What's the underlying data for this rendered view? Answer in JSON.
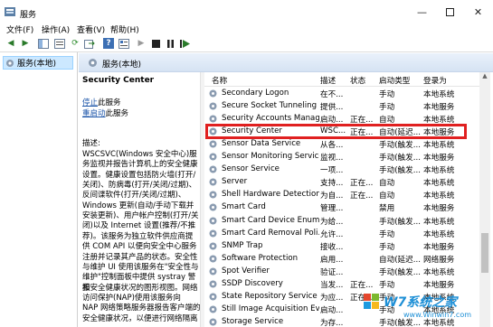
{
  "window": {
    "title": "服务"
  },
  "menubar": {
    "items": [
      "文件(F)",
      "操作(A)",
      "查看(V)",
      "帮助(H)"
    ]
  },
  "tree": {
    "root": "服务(本地)"
  },
  "main": {
    "header": "服务(本地)"
  },
  "description": {
    "service_name": "Security Center",
    "stop_link": "停止",
    "stop_suffix": "此服务",
    "restart_link": "重启动",
    "restart_suffix": "此服务",
    "desc_label": "描述:",
    "desc_lines": [
      "WSCSVC(Windows 安全中心)服",
      "务监视并报告计算机上的安全健康",
      "设置。健康设置包括防火墙(打开/",
      "关闭)、防病毒(打开/关闭/过期)、",
      "反间谍软件(打开/关闭/过期)、",
      "Windows 更新(自动/手动下载并",
      "安装更新)、用户帐户控制(打开/关",
      "闭)以及 Internet 设置(推荐/不推",
      "荐)。该服务为独立软件供应商提",
      "供 COM API 以便向安全中心服务",
      "注册并记录其产品的状态。安全性",
      "与维护 UI 使用该服务在\"安全性与",
      "维护\"控制面板中提供 systray 警报",
      "和安全健康状况的图形视图。网络",
      "访问保护(NAP)使用该服务向",
      "NAP 网络策略服务器报告客户端的",
      "安全健康状况，以便进行网络隔离"
    ]
  },
  "table": {
    "columns": [
      "名称",
      "描述",
      "状态",
      "启动类型",
      "登录为"
    ],
    "rows": [
      {
        "name": "Secondary Logon",
        "desc": "在不...",
        "status": "",
        "startup": "手动",
        "logon": "本地系统"
      },
      {
        "name": "Secure Socket Tunneling ...",
        "desc": "提供...",
        "status": "",
        "startup": "手动",
        "logon": "本地服务"
      },
      {
        "name": "Security Accounts Manag...",
        "desc": "启动...",
        "status": "正在...",
        "startup": "自动",
        "logon": "本地系统"
      },
      {
        "name": "Security Center",
        "desc": "WSC...",
        "status": "正在...",
        "startup": "自动(延迟...",
        "logon": "本地服务"
      },
      {
        "name": "Sensor Data Service",
        "desc": "从各...",
        "status": "",
        "startup": "手动(触发...",
        "logon": "本地系统"
      },
      {
        "name": "Sensor Monitoring Service",
        "desc": "监视...",
        "status": "",
        "startup": "手动(触发...",
        "logon": "本地服务"
      },
      {
        "name": "Sensor Service",
        "desc": "一项...",
        "status": "",
        "startup": "手动(触发...",
        "logon": "本地系统"
      },
      {
        "name": "Server",
        "desc": "支持...",
        "status": "正在...",
        "startup": "自动",
        "logon": "本地系统"
      },
      {
        "name": "Shell Hardware Detection",
        "desc": "为自...",
        "status": "正在...",
        "startup": "自动",
        "logon": "本地系统"
      },
      {
        "name": "Smart Card",
        "desc": "管理...",
        "status": "",
        "startup": "禁用",
        "logon": "本地服务"
      },
      {
        "name": "Smart Card Device Enum...",
        "desc": "为给...",
        "status": "",
        "startup": "手动(触发...",
        "logon": "本地系统"
      },
      {
        "name": "Smart Card Removal Poli...",
        "desc": "允许...",
        "status": "",
        "startup": "手动",
        "logon": "本地系统"
      },
      {
        "name": "SNMP Trap",
        "desc": "接收...",
        "status": "",
        "startup": "手动",
        "logon": "本地服务"
      },
      {
        "name": "Software Protection",
        "desc": "启用...",
        "status": "",
        "startup": "自动(延迟...",
        "logon": "网络服务"
      },
      {
        "name": "Spot Verifier",
        "desc": "验证...",
        "status": "",
        "startup": "手动(触发...",
        "logon": "本地系统"
      },
      {
        "name": "SSDP Discovery",
        "desc": "当发...",
        "status": "正在...",
        "startup": "手动",
        "logon": "本地服务"
      },
      {
        "name": "State Repository Service",
        "desc": "为应...",
        "status": "正在...",
        "startup": "手动",
        "logon": "本地系统"
      },
      {
        "name": "Still Image Acquisition Ev...",
        "desc": "启动...",
        "status": "",
        "startup": "手动",
        "logon": "本地系统"
      },
      {
        "name": "Storage Service",
        "desc": "为存...",
        "status": "",
        "startup": "手动(触发...",
        "logon": "本地系统"
      }
    ]
  },
  "watermark": {
    "text": "W7系统之家",
    "url": "www.Winwin7.com"
  },
  "colors": {
    "highlight": "#e02020",
    "link": "#1a53a8",
    "header_bg": "#d6e3f3",
    "select_bg": "#cce8ff"
  }
}
